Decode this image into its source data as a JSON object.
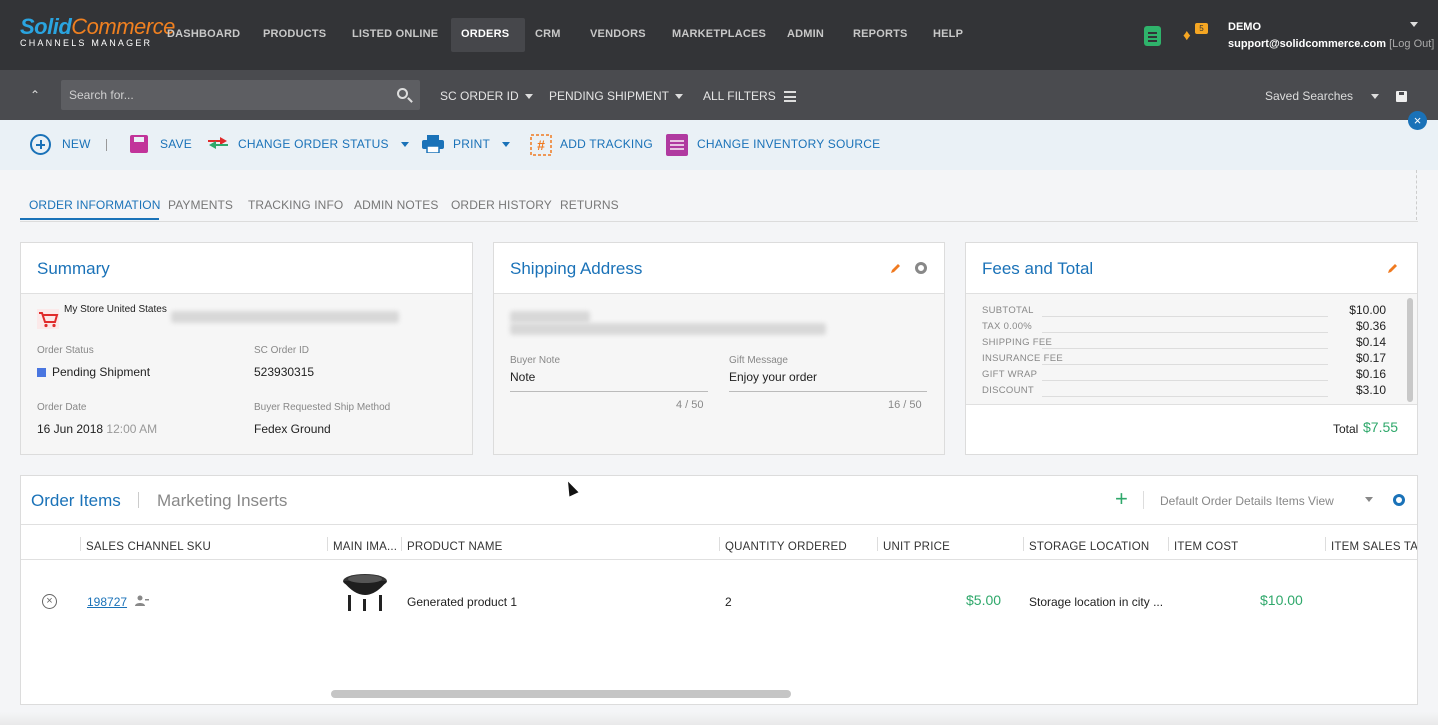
{
  "brand": {
    "logo_top_a": "Solid",
    "logo_top_b": "Commerce",
    "logo_bottom": "CHANNELS MANAGER"
  },
  "nav": {
    "items": [
      "DASHBOARD",
      "PRODUCTS",
      "LISTED ONLINE",
      "ORDERS",
      "CRM",
      "VENDORS",
      "MARKETPLACES",
      "ADMIN",
      "REPORTS",
      "HELP"
    ],
    "active": "ORDERS",
    "notification_count": "5",
    "user_name": "DEMO",
    "user_email": "support@solidcommerce.com",
    "logout": "[Log Out]"
  },
  "search": {
    "placeholder": "Search for...",
    "field_dropdown": "SC ORDER ID",
    "status_dropdown": "PENDING SHIPMENT",
    "all_filters": "ALL FILTERS",
    "saved_searches": "Saved Searches"
  },
  "toolbar": {
    "new": "NEW",
    "save": "SAVE",
    "change_status": "CHANGE ORDER STATUS",
    "print": "PRINT",
    "add_tracking": "ADD TRACKING",
    "change_inventory": "CHANGE INVENTORY SOURCE",
    "close": "×"
  },
  "tabs": [
    "ORDER INFORMATION",
    "PAYMENTS",
    "TRACKING INFO",
    "ADMIN NOTES",
    "ORDER HISTORY",
    "RETURNS"
  ],
  "summary": {
    "title": "Summary",
    "store": "My Store United States",
    "order_status_label": "Order Status",
    "order_status": "Pending Shipment",
    "sc_order_id_label": "SC Order ID",
    "sc_order_id": "523930315",
    "order_date_label": "Order Date",
    "order_date": "16 Jun 2018",
    "order_time": "12:00 AM",
    "ship_method_label": "Buyer Requested Ship Method",
    "ship_method": "Fedex Ground"
  },
  "shipping": {
    "title": "Shipping Address",
    "buyer_note_label": "Buyer Note",
    "buyer_note": "Note",
    "buyer_note_count": "4 / 50",
    "gift_message_label": "Gift Message",
    "gift_message": "Enjoy your order",
    "gift_message_count": "16 / 50"
  },
  "fees": {
    "title": "Fees and Total",
    "rows": [
      {
        "label": "SUBTOTAL",
        "value": "$10.00"
      },
      {
        "label": "TAX 0.00%",
        "value": "$0.36"
      },
      {
        "label": "SHIPPING FEE",
        "value": "$0.14"
      },
      {
        "label": "INSURANCE FEE",
        "value": "$0.17"
      },
      {
        "label": "GIFT WRAP",
        "value": "$0.16"
      },
      {
        "label": "DISCOUNT",
        "value": "$3.10"
      }
    ],
    "total_label": "Total",
    "total_value": "$7.55"
  },
  "items": {
    "tab_items": "Order Items",
    "tab_inserts": "Marketing Inserts",
    "view": "Default Order Details Items View",
    "columns": [
      "SALES CHANNEL SKU",
      "MAIN IMA...",
      "PRODUCT NAME",
      "QUANTITY ORDERED",
      "UNIT PRICE",
      "STORAGE LOCATION",
      "ITEM COST",
      "ITEM SALES TAX"
    ],
    "rows": [
      {
        "sku": "198727",
        "product_name": "Generated product 1",
        "quantity": "2",
        "unit_price": "$5.00",
        "storage_location": "Storage location in city ...",
        "item_cost": "$10.00"
      }
    ]
  },
  "colors": {
    "accent": "#1a72b8",
    "money": "#2fa86b",
    "nav_bg": "#333437"
  }
}
